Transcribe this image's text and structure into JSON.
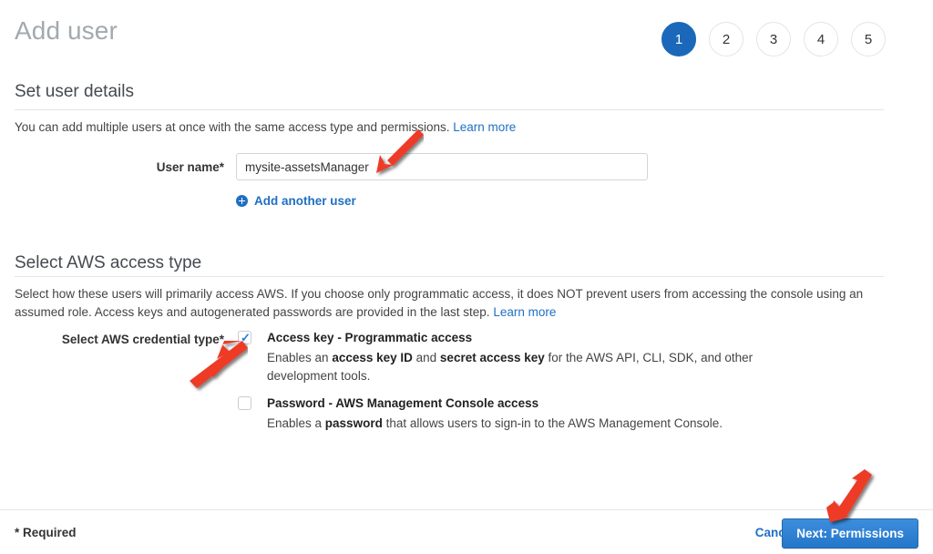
{
  "header": {
    "title": "Add user",
    "steps": [
      {
        "label": "1",
        "active": true
      },
      {
        "label": "2",
        "active": false
      },
      {
        "label": "3",
        "active": false
      },
      {
        "label": "4",
        "active": false
      },
      {
        "label": "5",
        "active": false
      }
    ]
  },
  "user_details": {
    "heading": "Set user details",
    "description": "You can add multiple users at once with the same access type and permissions.",
    "learn_more": "Learn more",
    "username_label": "User name*",
    "username_value": "mysite-assetsManager",
    "username_placeholder": "",
    "add_another_user": "Add another user"
  },
  "access_type": {
    "heading": "Select AWS access type",
    "description_line1": "Select how these users will primarily access AWS. If you choose only programmatic access, it does NOT prevent users from accessing the console using",
    "description_line2": "an assumed role. Access keys and autogenerated passwords are provided in the last step.",
    "learn_more": "Learn more",
    "credential_label": "Select AWS credential type*",
    "options": [
      {
        "checked": true,
        "title": "Access key - Programmatic access",
        "desc_pre": "Enables an ",
        "desc_b1": "access key ID",
        "desc_mid": " and ",
        "desc_b2": "secret access key",
        "desc_post": " for the AWS API, CLI, SDK, and other development tools."
      },
      {
        "checked": false,
        "title": "Password - AWS Management Console access",
        "desc_pre": "Enables a ",
        "desc_b1": "password",
        "desc_mid": "",
        "desc_b2": "",
        "desc_post": " that allows users to sign-in to the AWS Management Console."
      }
    ]
  },
  "footer": {
    "required_note": "* Required",
    "cancel_label": "Cancel",
    "next_label": "Next: Permissions"
  },
  "colors": {
    "accent_blue": "#1b68ba",
    "link_blue": "#1f6fc4",
    "button_blue": "#2477c9",
    "annotation_red": "#ee3b28",
    "title_gray": "#a3a9ae"
  },
  "annotations": [
    {
      "name": "arrow-to-username-input",
      "direction": "down-left"
    },
    {
      "name": "arrow-to-credential-checkbox",
      "direction": "up-right"
    },
    {
      "name": "arrow-to-next-button",
      "direction": "down-left"
    }
  ]
}
